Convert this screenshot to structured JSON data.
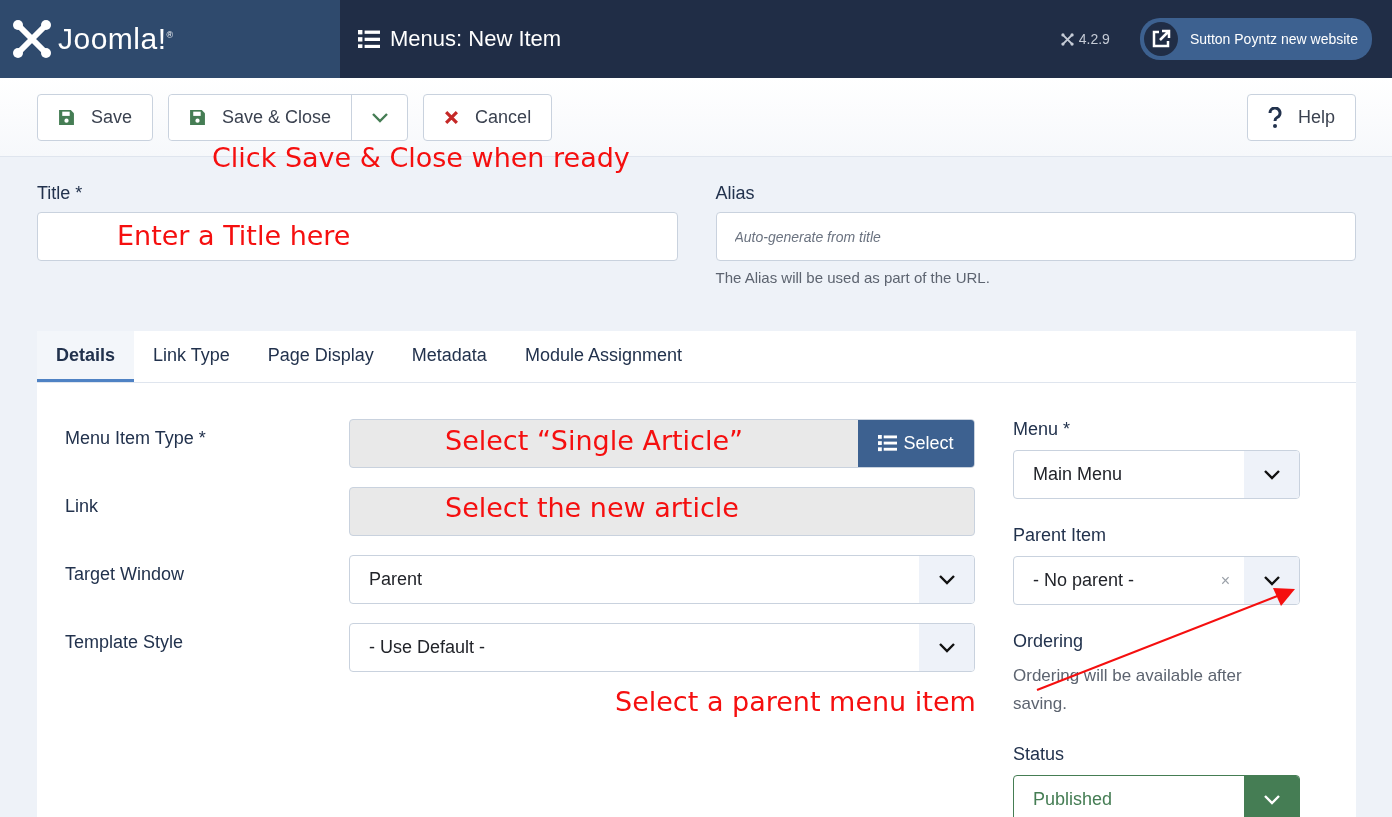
{
  "header": {
    "brand": "Joomla!$^{®}$",
    "page_title": "Menus: New Item",
    "version": "4.2.9",
    "site_link": "Sutton Poyntz new website"
  },
  "toolbar": {
    "buttons": [
      {
        "label": "Save",
        "kind": "save"
      },
      {
        "label": "Save & Close",
        "kind": "split"
      },
      {
        "label": "Cancel",
        "kind": "cancel"
      }
    ],
    "help": "Help"
  },
  "title_field": {
    "label": "Title *"
  },
  "alias_field": {
    "label": "Alias",
    "placeholder": "Auto-generate from title",
    "hint": "The Alias will be used as part of the URL."
  },
  "tabs": [
    {
      "label": "Details",
      "selected": true
    },
    {
      "label": "Link Type",
      "selected": false
    },
    {
      "label": "Page Display",
      "selected": false
    },
    {
      "label": "Metadata",
      "selected": false
    },
    {
      "label": "Module Assignment",
      "selected": false
    }
  ],
  "fields": [
    {
      "label": "Menu Item Type *",
      "kind": "picker",
      "button": "Select"
    },
    {
      "label": "Link",
      "kind": "readonly"
    },
    {
      "label": "Target Window",
      "kind": "dropdown",
      "value": "Parent"
    },
    {
      "label": "Template Style",
      "kind": "dropdown",
      "value": "- Use Default -"
    }
  ],
  "side": {
    "menu": {
      "label": "Menu *",
      "value": "Main Menu"
    },
    "parent": {
      "label": "Parent Item",
      "value": "- No parent -",
      "clear": "×"
    },
    "ordering": {
      "label": "Ordering",
      "note": "Ordering will be available after saving."
    },
    "status": {
      "label": "Status",
      "value": "Published"
    }
  },
  "annotations": [
    {
      "text": "Click Save & Close when ready",
      "kind": "label"
    },
    {
      "text": "Enter a Title here",
      "kind": "label"
    },
    {
      "text": "Select “Single Article”",
      "kind": "label"
    },
    {
      "text": "Select the new article",
      "kind": "label"
    },
    {
      "text": "Select a parent menu item",
      "kind": "arrow"
    }
  ]
}
